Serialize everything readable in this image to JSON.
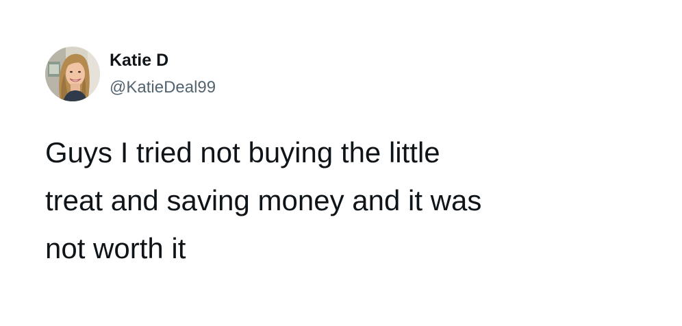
{
  "tweet": {
    "author": {
      "display_name": "Katie D",
      "handle": "@KatieDeal99"
    },
    "text_lines": [
      "Guys I tried not buying the little",
      "treat and saving money and it was",
      "not worth it"
    ]
  },
  "colors": {
    "text": "#0f1419",
    "handle": "#536471",
    "background": "#ffffff"
  },
  "icons": {
    "avatar": "profile-photo"
  }
}
